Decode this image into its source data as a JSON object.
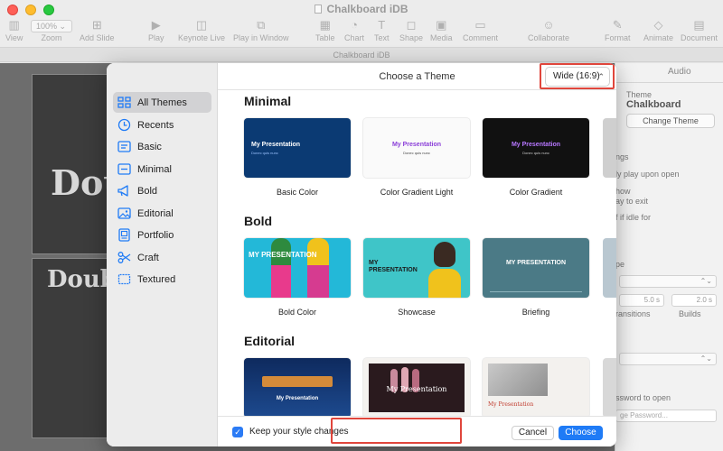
{
  "window": {
    "title": "Chalkboard iDB",
    "subtitle": "Chalkboard iDB",
    "toolbar": {
      "view": "View",
      "zoom_value": "100%",
      "zoom": "Zoom",
      "add_slide": "Add Slide",
      "play": "Play",
      "keynote_live": "Keynote Live",
      "play_in_window": "Play in Window",
      "table": "Table",
      "chart": "Chart",
      "text": "Text",
      "shape": "Shape",
      "media": "Media",
      "comment": "Comment",
      "collaborate": "Collaborate",
      "format": "Format",
      "animate": "Animate",
      "document": "Document"
    }
  },
  "background": {
    "chalk_text_1": "Dou",
    "chalk_text_2": "Doub",
    "inspector": {
      "tab_audio": "Audio",
      "theme_label": "Theme",
      "theme_name": "Chalkboard",
      "change_theme": "Change Theme",
      "line1": "ngs",
      "line2": "ly play upon open",
      "line3": "how",
      "line4": "ay to exit",
      "line5": "f if idle for",
      "line6": "pe",
      "val1": "5.0 s",
      "val2": "2.0 s",
      "lbl1": "ransitions",
      "lbl2": "Builds",
      "line7": "ssword to open",
      "placeholder": "ge Password..."
    }
  },
  "modal": {
    "header_title": "Choose a Theme",
    "aspect": "Wide (16:9)",
    "sidebar": [
      {
        "label": "All Themes",
        "icon": "grid-icon",
        "active": true
      },
      {
        "label": "Recents",
        "icon": "clock-icon"
      },
      {
        "label": "Basic",
        "icon": "basic-icon"
      },
      {
        "label": "Minimal",
        "icon": "minimal-icon"
      },
      {
        "label": "Bold",
        "icon": "megaphone-icon"
      },
      {
        "label": "Editorial",
        "icon": "image-icon"
      },
      {
        "label": "Portfolio",
        "icon": "portfolio-icon"
      },
      {
        "label": "Craft",
        "icon": "scissors-icon"
      },
      {
        "label": "Textured",
        "icon": "textured-icon"
      }
    ],
    "sections": [
      {
        "title": "Minimal",
        "themes": [
          {
            "name": "Basic Color",
            "thumb_title": "My Presentation",
            "thumb_sub": "Donec quis nunc"
          },
          {
            "name": "Color Gradient Light",
            "thumb_title": "My Presentation",
            "thumb_sub": "Donec quis nunc"
          },
          {
            "name": "Color Gradient",
            "thumb_title": "My Presentation",
            "thumb_sub": "Donec quis nunc"
          }
        ]
      },
      {
        "title": "Bold",
        "themes": [
          {
            "name": "Bold Color",
            "thumb_title": "MY PRESENTATION"
          },
          {
            "name": "Showcase",
            "thumb_title": "MY PRESENTATION"
          },
          {
            "name": "Briefing",
            "thumb_title": "MY PRESENTATION"
          }
        ]
      },
      {
        "title": "Editorial",
        "themes": [
          {
            "thumb_title": "My Presentation"
          },
          {
            "thumb_title": "My Presentation"
          },
          {
            "thumb_title": "My Presentation"
          }
        ]
      }
    ],
    "footer": {
      "checkbox_checked": true,
      "checkbox_label": "Keep your style changes",
      "cancel": "Cancel",
      "choose": "Choose"
    },
    "colors": {
      "accent": "#1f7bf6",
      "highlight": "#e0463c",
      "basic_color_bg": "#0b3a73",
      "gradient_dark_bg": "#111111",
      "briefing_bg": "#4b7a86",
      "showcase_bg": "#3fc5c8"
    }
  }
}
